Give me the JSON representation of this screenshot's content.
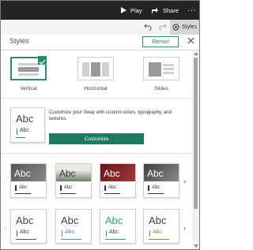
{
  "topbar": {
    "play_label": "Play",
    "share_label": "Share",
    "more_label": "···"
  },
  "toolbar": {
    "styles_label": "Styles"
  },
  "panel": {
    "title": "Styles",
    "remix_label": "Remix!",
    "layouts": [
      {
        "label": "Vertical",
        "selected": true
      },
      {
        "label": "Horizontal",
        "selected": false
      },
      {
        "label": "Slides",
        "selected": false
      }
    ],
    "customize": {
      "description": "Customize your Sway with custom colors, typography, and textures.",
      "button_label": "Customize",
      "preview_big": "Abc",
      "preview_small": "Abc"
    },
    "style_rows": [
      {
        "items": [
          {
            "big": "Abc",
            "small": "Abc",
            "photo_color": "#6d6d6d"
          },
          {
            "big": "Abc",
            "small": "Abc",
            "photo_color": "#7c8c75"
          },
          {
            "big": "Abc",
            "small": "Abc",
            "photo_color": "#7a1f22"
          },
          {
            "big": "Abc",
            "small": "Abc",
            "photo_color": "#5d5d5d"
          }
        ]
      },
      {
        "items": [
          {
            "big": "Abc",
            "small": "Abc",
            "accent": "#555555"
          },
          {
            "big": "Abc",
            "small": "Abc",
            "accent": "#4b8fb0"
          },
          {
            "big": "Abc",
            "small": "Abc",
            "accent": "#2f9e6e"
          },
          {
            "big": "Abc",
            "small": "Abc",
            "accent": "#8a8a3a"
          }
        ]
      }
    ]
  },
  "colors": {
    "accent_green": "#1f7a60",
    "topbar_bg": "#242424"
  }
}
